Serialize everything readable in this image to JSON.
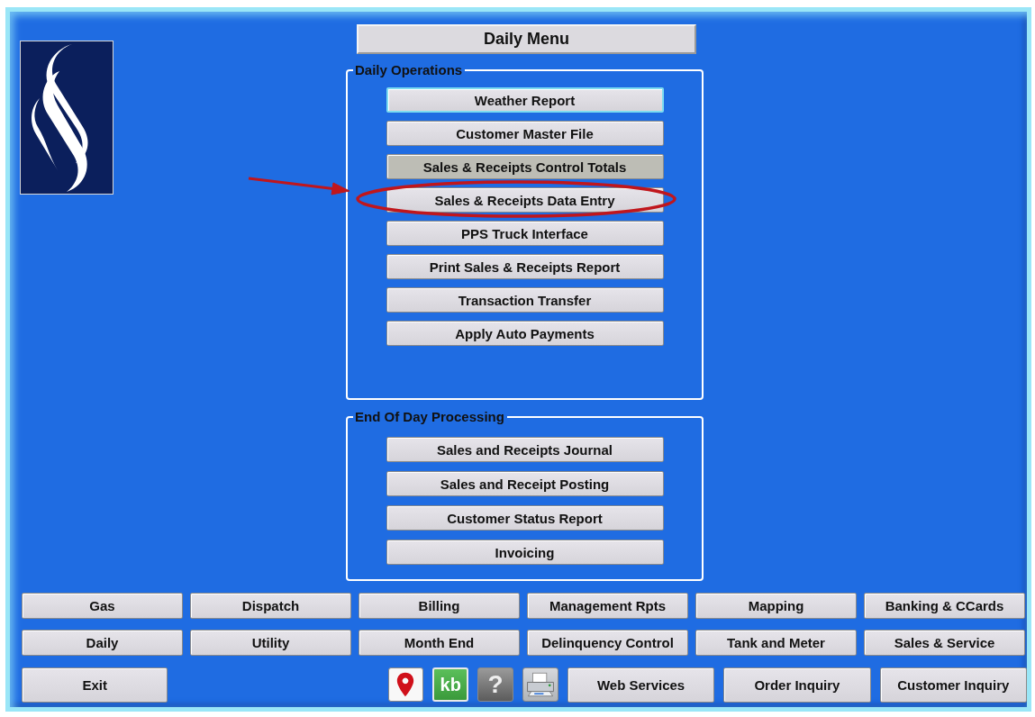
{
  "window": {
    "title": "Daily Menu"
  },
  "groups": [
    {
      "title": "Daily Operations",
      "buttons": [
        {
          "label": "Weather Report",
          "focused": true,
          "highlighted": false,
          "circled": false
        },
        {
          "label": "Customer Master File",
          "focused": false,
          "highlighted": false,
          "circled": false
        },
        {
          "label": "Sales & Receipts Control Totals",
          "focused": false,
          "highlighted": true,
          "circled": false
        },
        {
          "label": "Sales & Receipts Data Entry",
          "focused": false,
          "highlighted": false,
          "circled": true
        },
        {
          "label": "PPS Truck Interface",
          "focused": false,
          "highlighted": false,
          "circled": false
        },
        {
          "label": "Print Sales & Receipts Report",
          "focused": false,
          "highlighted": false,
          "circled": false
        },
        {
          "label": "Transaction Transfer",
          "focused": false,
          "highlighted": false,
          "circled": false
        },
        {
          "label": "Apply Auto Payments",
          "focused": false,
          "highlighted": false,
          "circled": false
        }
      ]
    },
    {
      "title": "End Of Day Processing",
      "buttons": [
        {
          "label": "Sales and Receipts Journal",
          "focused": false,
          "highlighted": false,
          "circled": false
        },
        {
          "label": "Sales and Receipt Posting",
          "focused": false,
          "highlighted": false,
          "circled": false
        },
        {
          "label": "Customer Status Report",
          "focused": false,
          "highlighted": false,
          "circled": false
        },
        {
          "label": "Invoicing",
          "focused": false,
          "highlighted": false,
          "circled": false
        }
      ]
    }
  ],
  "nav_rows": [
    [
      "Gas",
      "Dispatch",
      "Billing",
      "Management Rpts",
      "Mapping",
      "Banking & CCards"
    ],
    [
      "Daily",
      "Utility",
      "Month End",
      "Delinquency Control",
      "Tank and Meter",
      "Sales & Service"
    ]
  ],
  "toolbar": {
    "exit": "Exit",
    "icons": [
      {
        "kind": "map-pin"
      },
      {
        "kind": "kb",
        "text": "kb"
      },
      {
        "kind": "help",
        "text": "?"
      },
      {
        "kind": "printer"
      }
    ],
    "buttons": [
      "Web Services",
      "Order Inquiry",
      "Customer Inquiry"
    ]
  }
}
